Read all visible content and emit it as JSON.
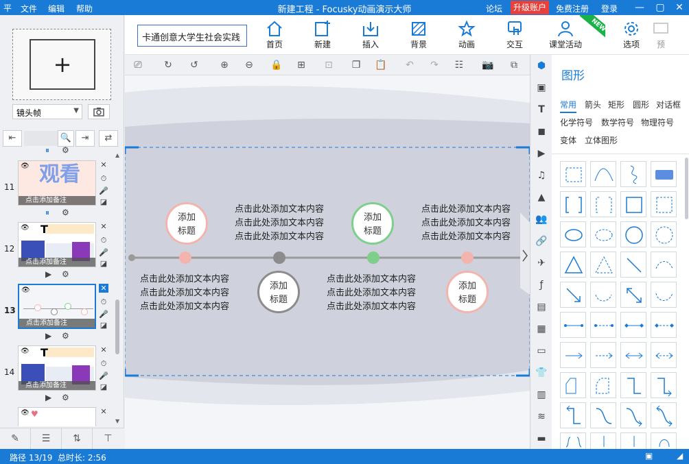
{
  "titlebar": {
    "logo": "平",
    "menu": [
      "文件",
      "编辑",
      "帮助"
    ],
    "title": "新建工程 - Focusky动画演示大师",
    "forum": "论坛",
    "upgrade": "升级账户",
    "register": "免费注册",
    "login": "登录"
  },
  "ribbon": {
    "project_name": "卡通创意大学生社会实践",
    "buttons": {
      "home": "首页",
      "new": "新建",
      "insert": "插入",
      "background": "背景",
      "animation": "动画",
      "interaction": "交互",
      "class_activity": "课堂活动",
      "options": "选项",
      "preview": "预"
    },
    "new_badge": "NEW"
  },
  "left": {
    "frame_type": "镜头帧",
    "slides": [
      {
        "num": "11",
        "note": "点击添加备注",
        "thumb_text": "观看"
      },
      {
        "num": "12",
        "note": "点击添加备注",
        "thumb_text": "T"
      },
      {
        "num": "13",
        "note": "点击添加备注",
        "thumb_text": ""
      },
      {
        "num": "14",
        "note": "点击添加备注",
        "thumb_text": "T"
      }
    ]
  },
  "canvas": {
    "circles": [
      "添加\n标题",
      "添加\n标题",
      "添加\n标题",
      "添加\n标题"
    ],
    "text_block": "点击此处添加文本内容\n点击此处添加文本内容\n点击此处添加文本内容",
    "colors": {
      "pink": "#f4b4ae",
      "gray": "#8c8c8c",
      "green": "#7fcf8c",
      "line": "#9a9a9a"
    }
  },
  "shape_panel": {
    "title": "图形",
    "categories_row1": [
      "常用",
      "箭头",
      "矩形",
      "圆形",
      "对话框"
    ],
    "categories_row2": [
      "化学符号",
      "数学符号",
      "物理符号"
    ],
    "categories_row3": [
      "变体",
      "立体图形"
    ]
  },
  "status": {
    "path": "路径 13/19",
    "duration": "总时长: 2:56"
  },
  "colors": {
    "accent": "#1a7bd6",
    "upgrade": "#e8403a",
    "new_badge": "#19b34a"
  }
}
